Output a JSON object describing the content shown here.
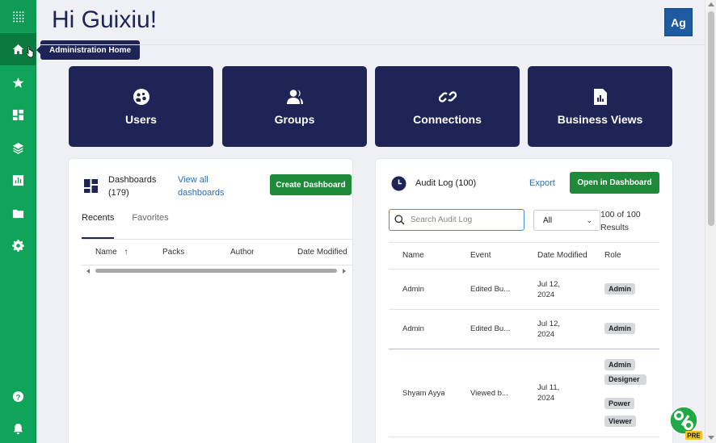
{
  "header": {
    "greeting": "Hi Guixiu!",
    "avatar_initials": "Ag"
  },
  "tooltip": "Administration Home",
  "sidebar": {
    "items": [
      {
        "icon": "apps-grid-icon"
      },
      {
        "icon": "home-icon",
        "active": true
      },
      {
        "icon": "star-icon"
      },
      {
        "icon": "dashboard-icon"
      },
      {
        "icon": "layers-icon"
      },
      {
        "icon": "chart-icon"
      },
      {
        "icon": "folder-icon"
      },
      {
        "icon": "gear-icon"
      },
      {
        "icon": "help-icon"
      },
      {
        "icon": "bell-icon"
      }
    ]
  },
  "tiles": [
    {
      "label": "Users",
      "icon": "users-icon"
    },
    {
      "label": "Groups",
      "icon": "groups-icon"
    },
    {
      "label": "Connections",
      "icon": "link-icon"
    },
    {
      "label": "Business Views",
      "icon": "report-icon"
    }
  ],
  "dashboards": {
    "title_line1": "Dashboards",
    "title_line2": "(179)",
    "view_all_line1": "View all",
    "view_all_line2": "dashboards",
    "create_button": "Create Dashboard",
    "tabs": [
      "Recents",
      "Favorites"
    ],
    "columns": [
      "Name",
      "Packs",
      "Author",
      "Date Modified"
    ]
  },
  "audit": {
    "title": "Audit Log (100)",
    "export": "Export",
    "open_button": "Open in Dashboard",
    "search_placeholder": "Search Audit Log",
    "filter_value": "All",
    "results_line1": "100 of 100",
    "results_line2": "Results",
    "columns": [
      "Name",
      "Event",
      "Date Modified",
      "Role"
    ],
    "rows": [
      {
        "name": "Admin",
        "event": "Edited Bu...",
        "date_line1": "Jul 12,",
        "date_line2": "2024",
        "roles": [
          "Admin"
        ]
      },
      {
        "name": "Admin",
        "event": "Edited Bu...",
        "date_line1": "Jul 12,",
        "date_line2": "2024",
        "roles": [
          "Admin"
        ]
      },
      {
        "name": "Shyam Ayyar",
        "event": "Viewed b...",
        "date_line1": "Jul 11,",
        "date_line2": "2024",
        "roles": [
          "Admin",
          "Designer",
          "Power",
          "Viewer"
        ]
      }
    ]
  },
  "badge_pre": "PRE",
  "colors": {
    "sidebar": "#10a35a",
    "tile": "#1e2456",
    "button": "#1f8a3a",
    "link": "#2a6fb5"
  }
}
